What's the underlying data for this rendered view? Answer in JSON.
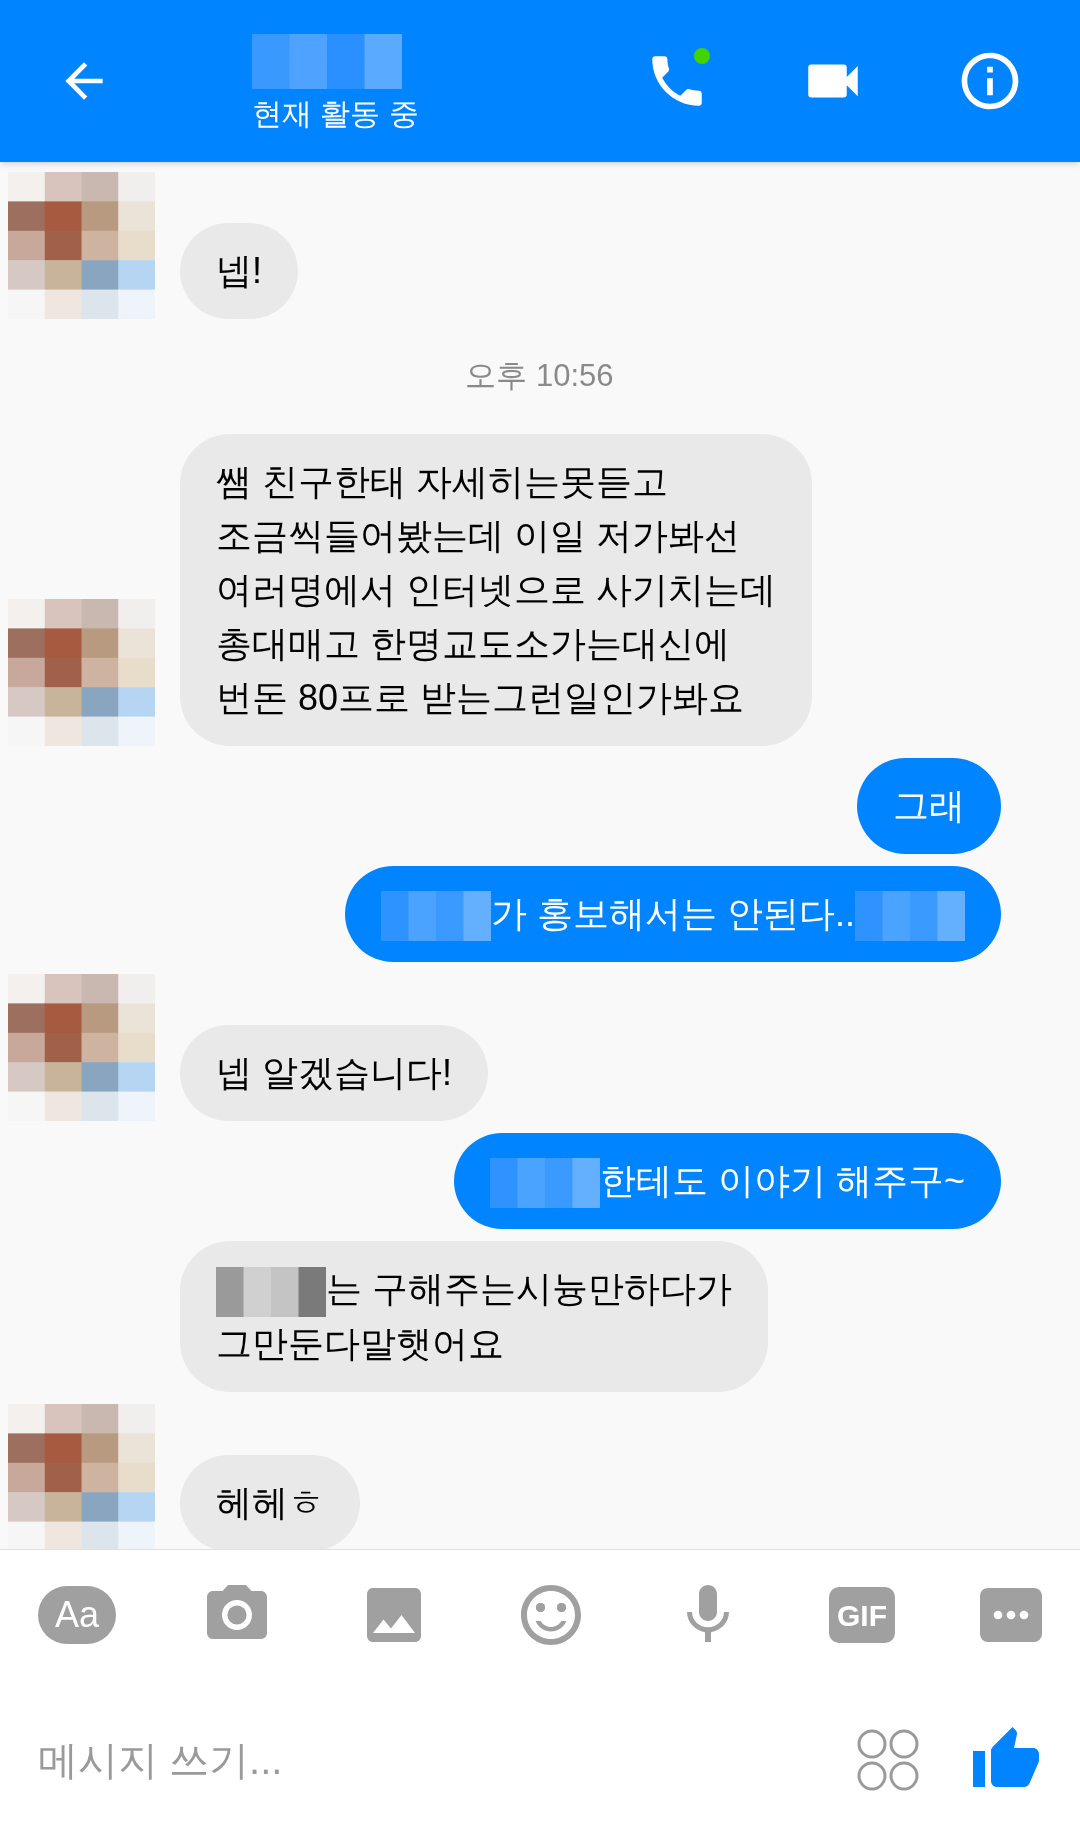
{
  "header": {
    "status": "현재 활동 중",
    "online": true
  },
  "messages": [
    {
      "kind": "incoming",
      "avatar": true,
      "parts": [
        {
          "kind": "text",
          "text": "넵!"
        }
      ]
    },
    {
      "kind": "timestamp",
      "text": "오후 10:56"
    },
    {
      "kind": "incoming",
      "avatar": true,
      "parts": [
        {
          "kind": "text",
          "text": "쌤 친구한태 자세히는못듣고\n조금씩들어봤는데 이일 저가봐선\n여러명에서 인터넷으로 사기치는데\n총대매고 한명교도소가는대신에\n번돈 80프로 받는그런일인가봐요"
        }
      ]
    },
    {
      "kind": "outgoing",
      "parts": [
        {
          "kind": "text",
          "text": "그래"
        }
      ]
    },
    {
      "kind": "outgoing",
      "parts": [
        {
          "kind": "redacted"
        },
        {
          "kind": "text",
          "text": "가 홍보해서는 안된다.."
        },
        {
          "kind": "redacted"
        }
      ]
    },
    {
      "kind": "incoming",
      "avatar": true,
      "parts": [
        {
          "kind": "text",
          "text": "넵 알겠습니다!"
        }
      ]
    },
    {
      "kind": "outgoing",
      "parts": [
        {
          "kind": "redacted"
        },
        {
          "kind": "text",
          "text": "한테도 이야기 해주구~"
        }
      ]
    },
    {
      "kind": "incoming",
      "avatar": false,
      "parts": [
        {
          "kind": "redacted"
        },
        {
          "kind": "text",
          "text": "는 구해주는시늉만하다가"
        },
        {
          "kind": "break"
        },
        {
          "kind": "text",
          "text": "그만둔다말햇어요"
        }
      ]
    },
    {
      "kind": "incoming",
      "avatar": true,
      "parts": [
        {
          "kind": "text",
          "text": "헤헤ㅎ"
        }
      ]
    }
  ],
  "toolbar": {
    "text_label": "Aa",
    "gif_label": "GIF"
  },
  "composer": {
    "placeholder": "메시지 쓰기..."
  }
}
